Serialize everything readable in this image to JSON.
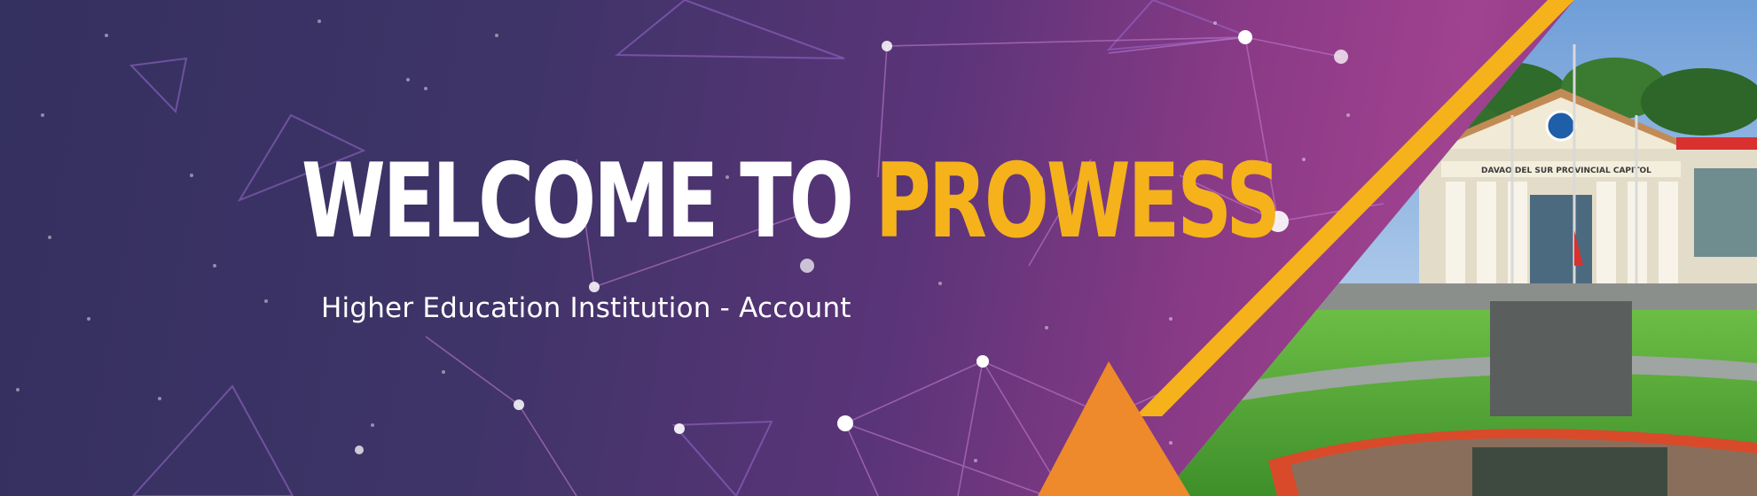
{
  "banner": {
    "headline_part1": "WELCOME TO",
    "headline_part2": "PROWESS",
    "subtitle": "Higher Education Institution - Account"
  },
  "photo": {
    "building_sign": "DAVAO DEL SUR PROVINCIAL CAPITOL"
  },
  "colors": {
    "background_start": "#34305f",
    "background_end": "#a0428f",
    "accent_yellow": "#f5b21b",
    "accent_orange": "#ee8a2c"
  }
}
